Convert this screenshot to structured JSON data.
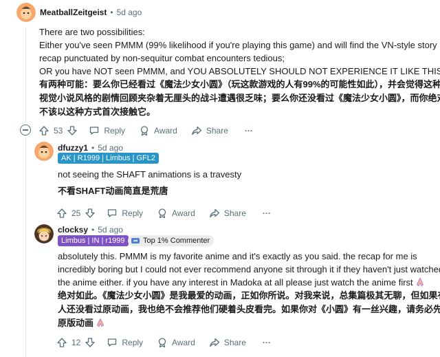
{
  "comments": [
    {
      "author": "MeatballZeitgeist",
      "separator": "•",
      "time": "5d ago",
      "body": [
        "There are two possibilities:",
        "Either you've seen PMMM (99% likelihood if you're playing this game) and will find the VN-style story",
        "recap punctuated by non-sequitur combat encounters tedious;",
        "OR you have NOT seen PMMM, and YOU ABSOLUTELY SHOULD NOT EXPERIENCE IT LIKE THIS."
      ],
      "translation": [
        "有两种可能：要么你已经看过《魔法少女小圆》（玩这款游戏的人有99%的可能性如此），并会觉得这种",
        "视觉小说风格的剧情回顾夹杂着无厘头的战斗遭遇很乏味；要么你还没看过《魔法少女小圆》，而你绝对",
        "不该以这种方式首次接触它。"
      ],
      "votes": "53",
      "reply": "Reply",
      "award": "Award",
      "share": "Share",
      "more": "···"
    },
    {
      "author": "dfuzzy1",
      "separator": "•",
      "time": "5d ago",
      "flair": "AK | R1999 | Limbus | GFL2",
      "body": [
        "not seeing the SHAFT animations is a travesty"
      ],
      "translation": [
        "不看SHAFT动画简直是荒唐"
      ],
      "votes": "25",
      "reply": "Reply",
      "award": "Award",
      "share": "Share",
      "more": "···"
    },
    {
      "author": "clocksy",
      "separator": "•",
      "time": "5d ago",
      "flair": "Limbus | IN | r1999",
      "badge": "Top 1% Commenter",
      "body": [
        "absolutely this. PMMM is my favorite anime and it's exactly as you said. the recap for me is",
        "incredibly boring but I could not ever recommend anyone sit through it if they haven't just watched",
        "the anime either. if you have any interest in Madoka at all please just watch the anime first"
      ],
      "translation": [
        "绝对如此。《魔法少女小圆》是我最爱的动画，正如你所说。对我来说，总集篇极其无聊，但如果有",
        "人还没看过原动画，我也绝不会推荐他们硬着头皮看完。如果你对《小圆》有一丝兴趣，请务必先看",
        "原版动画"
      ],
      "votes": "12",
      "reply": "Reply",
      "award": "Award",
      "share": "Share",
      "more": "···"
    }
  ],
  "colors": {
    "text": "#1a1a1b",
    "meta": "#576f76",
    "flair_blue": "#2a96c7",
    "flair_purple": "#7e53c1",
    "badge_bg": "#e9ebed",
    "thread_line": "#dfe3e6"
  },
  "icons": [
    "upvote-icon",
    "downvote-icon",
    "reply-icon",
    "award-icon",
    "share-icon",
    "collapse-icon",
    "pray-emoji-icon",
    "top-commenter-icon"
  ]
}
